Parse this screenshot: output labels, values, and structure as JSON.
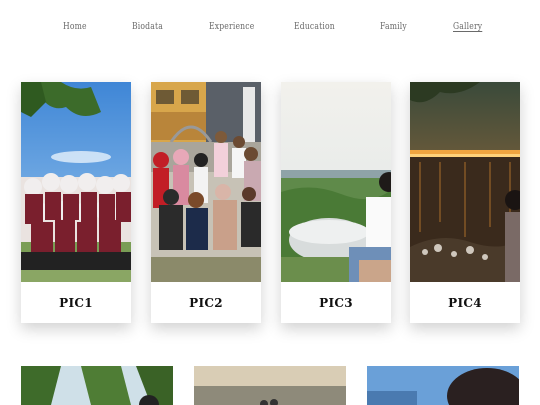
{
  "nav": {
    "items": [
      "Home",
      "Biodata",
      "Experience",
      "Education",
      "Family",
      "Gallery"
    ],
    "active": "Gallery"
  },
  "gallery": {
    "cards": [
      {
        "caption": "PIC1"
      },
      {
        "caption": "PIC2"
      },
      {
        "caption": "PIC3"
      },
      {
        "caption": "PIC4"
      }
    ]
  },
  "colors": {
    "nav_text": "#6a6a6a",
    "caption_text": "#111111",
    "background": "#ffffff"
  }
}
